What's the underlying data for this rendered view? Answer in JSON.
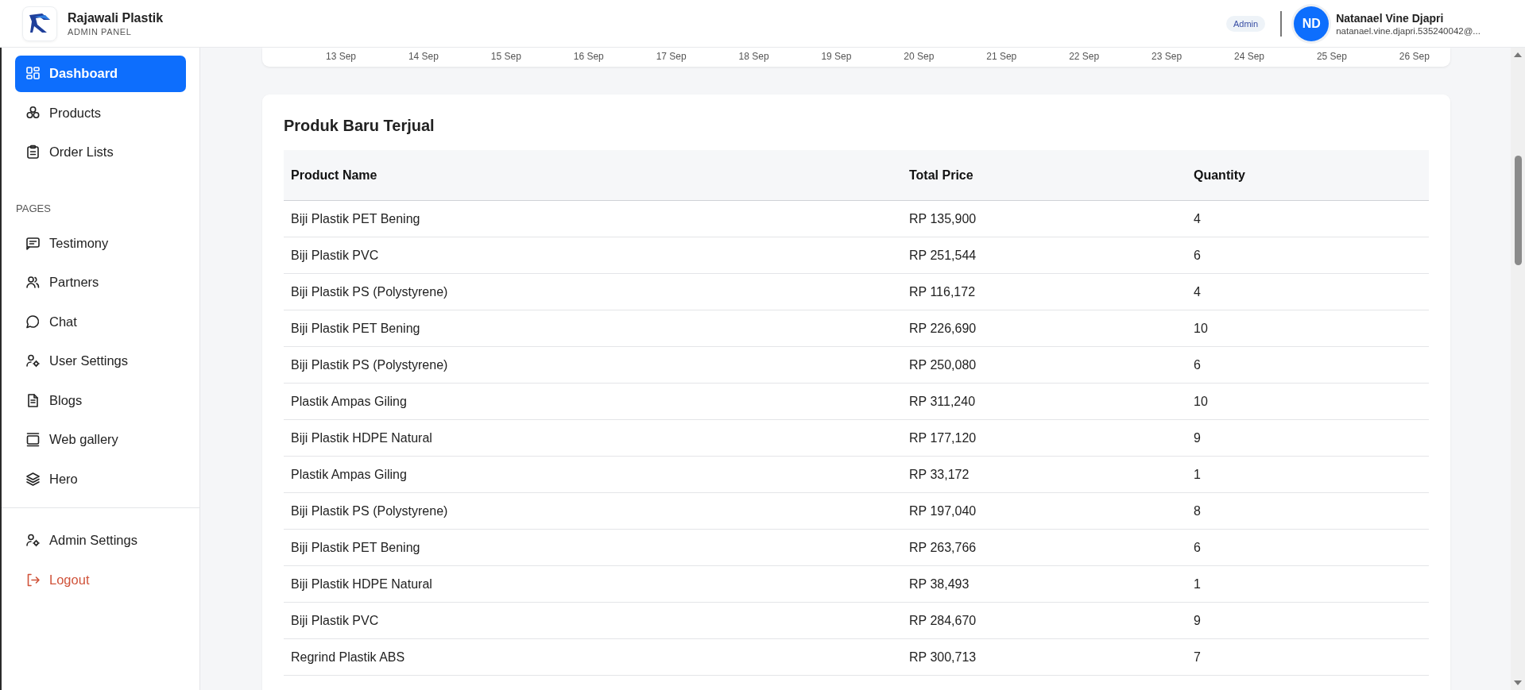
{
  "brand": {
    "title": "Rajawali Plastik",
    "subtitle": "ADMIN PANEL"
  },
  "header": {
    "role_badge": "Admin",
    "user": {
      "initials": "ND",
      "name": "Natanael Vine Djapri",
      "email": "natanael.vine.djapri.535240042@..."
    }
  },
  "sidebar": {
    "main_items": [
      {
        "label": "Dashboard",
        "selected": true,
        "kind": "normal"
      },
      {
        "label": "Products",
        "selected": false,
        "kind": "normal"
      },
      {
        "label": "Order Lists",
        "selected": false,
        "kind": "normal"
      }
    ],
    "pages_heading": "PAGES",
    "page_items": [
      {
        "label": "Testimony",
        "selected": false,
        "kind": "normal"
      },
      {
        "label": "Partners",
        "selected": false,
        "kind": "normal"
      },
      {
        "label": "Chat",
        "selected": false,
        "kind": "normal"
      },
      {
        "label": "User Settings",
        "selected": false,
        "kind": "normal"
      },
      {
        "label": "Blogs",
        "selected": false,
        "kind": "normal"
      },
      {
        "label": "Web gallery",
        "selected": false,
        "kind": "normal"
      },
      {
        "label": "Hero",
        "selected": false,
        "kind": "normal"
      }
    ],
    "bottom_items": [
      {
        "label": "Admin Settings",
        "selected": false,
        "kind": "normal"
      },
      {
        "label": "Logout",
        "selected": false,
        "kind": "danger"
      }
    ]
  },
  "chart_axis": {
    "x_labels": [
      "13 Sep",
      "14 Sep",
      "15 Sep",
      "16 Sep",
      "17 Sep",
      "18 Sep",
      "19 Sep",
      "20 Sep",
      "21 Sep",
      "22 Sep",
      "23 Sep",
      "24 Sep",
      "25 Sep",
      "26 Sep"
    ]
  },
  "table": {
    "title": "Produk Baru Terjual",
    "columns": [
      "Product Name",
      "Total Price",
      "Quantity"
    ],
    "rows": [
      [
        "Biji Plastik PET Bening",
        "RP 135,900",
        "4"
      ],
      [
        "Biji Plastik PVC",
        "RP 251,544",
        "6"
      ],
      [
        "Biji Plastik PS (Polystyrene)",
        "RP 116,172",
        "4"
      ],
      [
        "Biji Plastik PET Bening",
        "RP 226,690",
        "10"
      ],
      [
        "Biji Plastik PS (Polystyrene)",
        "RP 250,080",
        "6"
      ],
      [
        "Plastik Ampas Giling",
        "RP 311,240",
        "10"
      ],
      [
        "Biji Plastik HDPE Natural",
        "RP 177,120",
        "9"
      ],
      [
        "Plastik Ampas Giling",
        "RP 33,172",
        "1"
      ],
      [
        "Biji Plastik PS (Polystyrene)",
        "RP 197,040",
        "8"
      ],
      [
        "Biji Plastik PET Bening",
        "RP 263,766",
        "6"
      ],
      [
        "Biji Plastik HDPE Natural",
        "RP 38,493",
        "1"
      ],
      [
        "Biji Plastik PVC",
        "RP 284,670",
        "9"
      ],
      [
        "Regrind Plastik ABS",
        "RP 300,713",
        "7"
      ]
    ]
  }
}
